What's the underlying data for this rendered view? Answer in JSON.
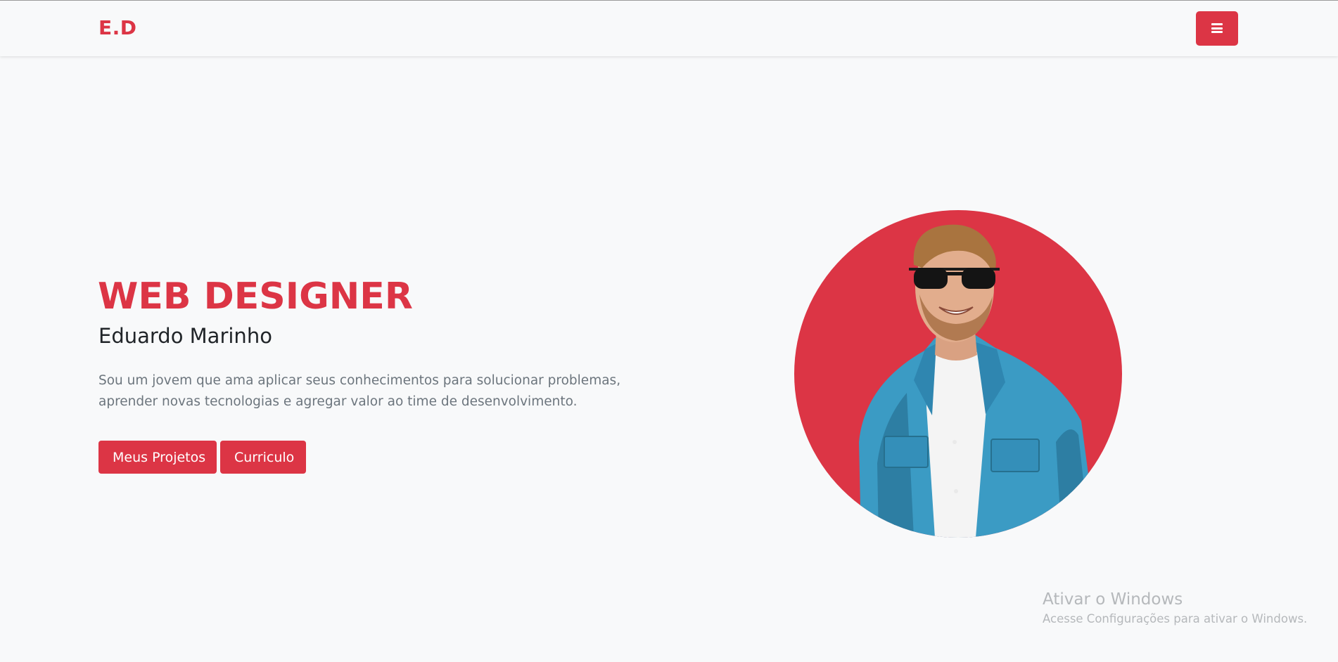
{
  "navbar": {
    "brand": "E.D",
    "menu_icon": "hamburger-menu-icon"
  },
  "hero": {
    "title": "WEB DESIGNER",
    "name": "Eduardo Marinho",
    "description": "Sou um jovem que ama aplicar seus conhecimentos para solucionar problemas, aprender novas tecnologias e agregar valor ao time de desenvolvimento.",
    "buttons": {
      "projects": "Meus Projetos",
      "cv": "Curriculo"
    }
  },
  "watermark": {
    "title": "Ativar o Windows",
    "subtitle": "Acesse Configurações para ativar o Windows."
  },
  "colors": {
    "accent": "#dc3545",
    "background": "#f8f9fa",
    "text_dark": "#212529",
    "text_muted": "#6c757d",
    "denim": "#3b9bc4"
  }
}
